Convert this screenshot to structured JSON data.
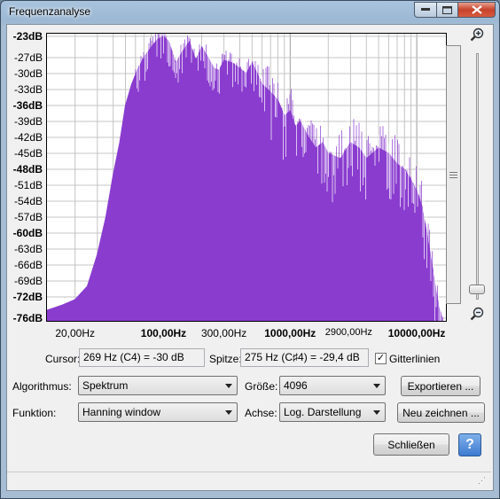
{
  "window": {
    "title": "Frequenzanalyse"
  },
  "chart_data": {
    "type": "area",
    "color": "#8a3ccf",
    "xscale": "log",
    "xlim": [
      12,
      17000
    ],
    "ylim": [
      -76,
      -23
    ],
    "yticks": [
      {
        "label": "-23dB",
        "value": -23,
        "bold": true
      },
      {
        "label": "-27dB",
        "value": -27,
        "bold": false
      },
      {
        "label": "-30dB",
        "value": -30,
        "bold": false
      },
      {
        "label": "-33dB",
        "value": -33,
        "bold": false
      },
      {
        "label": "-36dB",
        "value": -36,
        "bold": true
      },
      {
        "label": "-39dB",
        "value": -39,
        "bold": false
      },
      {
        "label": "-42dB",
        "value": -42,
        "bold": false
      },
      {
        "label": "-45dB",
        "value": -45,
        "bold": false
      },
      {
        "label": "-48dB",
        "value": -48,
        "bold": true
      },
      {
        "label": "-51dB",
        "value": -51,
        "bold": false
      },
      {
        "label": "-54dB",
        "value": -54,
        "bold": false
      },
      {
        "label": "-57dB",
        "value": -57,
        "bold": false
      },
      {
        "label": "-60dB",
        "value": -60,
        "bold": true
      },
      {
        "label": "-63dB",
        "value": -63,
        "bold": false
      },
      {
        "label": "-66dB",
        "value": -66,
        "bold": false
      },
      {
        "label": "-69dB",
        "value": -69,
        "bold": false
      },
      {
        "label": "-72dB",
        "value": -72,
        "bold": true
      },
      {
        "label": "-76dB",
        "value": -76,
        "bold": true
      }
    ],
    "xticks": [
      {
        "label": "20,00Hz",
        "value": 20,
        "style": "normal"
      },
      {
        "label": "100,00Hz",
        "value": 100,
        "style": "bold"
      },
      {
        "label": "300,00Hz",
        "value": 300,
        "style": "normal"
      },
      {
        "label": "1000,00Hz",
        "value": 1000,
        "style": "bold"
      },
      {
        "label": "2900,00Hz",
        "value": 2900,
        "style": "small"
      },
      {
        "label": "10000,00Hz",
        "value": 10000,
        "style": "bold"
      }
    ],
    "grid": true,
    "envelope": [
      {
        "x": 12,
        "y": -74.5
      },
      {
        "x": 16,
        "y": -73.5
      },
      {
        "x": 20,
        "y": -72.5
      },
      {
        "x": 25,
        "y": -70
      },
      {
        "x": 30,
        "y": -64
      },
      {
        "x": 35,
        "y": -57
      },
      {
        "x": 40,
        "y": -49
      },
      {
        "x": 45,
        "y": -43
      },
      {
        "x": 50,
        "y": -36
      },
      {
        "x": 56,
        "y": -32
      },
      {
        "x": 63,
        "y": -29
      },
      {
        "x": 70,
        "y": -27
      },
      {
        "x": 80,
        "y": -25
      },
      {
        "x": 90,
        "y": -23.5
      },
      {
        "x": 100,
        "y": -23
      },
      {
        "x": 110,
        "y": -24
      },
      {
        "x": 125,
        "y": -28
      },
      {
        "x": 140,
        "y": -26
      },
      {
        "x": 160,
        "y": -24
      },
      {
        "x": 180,
        "y": -27.5
      },
      {
        "x": 200,
        "y": -25
      },
      {
        "x": 225,
        "y": -27
      },
      {
        "x": 250,
        "y": -29
      },
      {
        "x": 275,
        "y": -29.4
      },
      {
        "x": 300,
        "y": -27.5
      },
      {
        "x": 350,
        "y": -28
      },
      {
        "x": 400,
        "y": -29
      },
      {
        "x": 450,
        "y": -30
      },
      {
        "x": 500,
        "y": -28
      },
      {
        "x": 550,
        "y": -30
      },
      {
        "x": 600,
        "y": -32
      },
      {
        "x": 700,
        "y": -33.5
      },
      {
        "x": 800,
        "y": -35
      },
      {
        "x": 900,
        "y": -38
      },
      {
        "x": 1000,
        "y": -37
      },
      {
        "x": 1100,
        "y": -40
      },
      {
        "x": 1200,
        "y": -39
      },
      {
        "x": 1400,
        "y": -42
      },
      {
        "x": 1600,
        "y": -44
      },
      {
        "x": 1800,
        "y": -43
      },
      {
        "x": 2000,
        "y": -45
      },
      {
        "x": 2500,
        "y": -46
      },
      {
        "x": 3000,
        "y": -43
      },
      {
        "x": 3500,
        "y": -44
      },
      {
        "x": 4000,
        "y": -46
      },
      {
        "x": 5000,
        "y": -44
      },
      {
        "x": 6000,
        "y": -45
      },
      {
        "x": 7000,
        "y": -47
      },
      {
        "x": 8000,
        "y": -48
      },
      {
        "x": 9000,
        "y": -50
      },
      {
        "x": 10000,
        "y": -52
      },
      {
        "x": 11000,
        "y": -55
      },
      {
        "x": 12000,
        "y": -60
      },
      {
        "x": 13000,
        "y": -65
      },
      {
        "x": 14000,
        "y": -70
      },
      {
        "x": 15000,
        "y": -74
      },
      {
        "x": 16000,
        "y": -76
      }
    ]
  },
  "controls": {
    "cursor_label": "Cursor:",
    "cursor_value": "269 Hz (C4) = -30 dB",
    "peak_label": "Spitze:",
    "peak_value": "275 Hz (C♯4) = -29,4 dB",
    "grid_checkbox_label": "Gitterlinien",
    "grid_checked": true,
    "algorithm_label": "Algorithmus:",
    "algorithm_value": "Spektrum",
    "size_label": "Größe:",
    "size_value": "4096",
    "function_label": "Funktion:",
    "function_value": "Hanning window",
    "axis_label": "Achse:",
    "axis_value": "Log. Darstellung",
    "export_button": "Exportieren ...",
    "redraw_button": "Neu zeichnen ...",
    "close_button": "Schließen",
    "help_button": "?"
  },
  "icons": {
    "zoom_in": "zoom-in-magnifier",
    "zoom_out": "zoom-out-magnifier",
    "help": "help-question"
  }
}
